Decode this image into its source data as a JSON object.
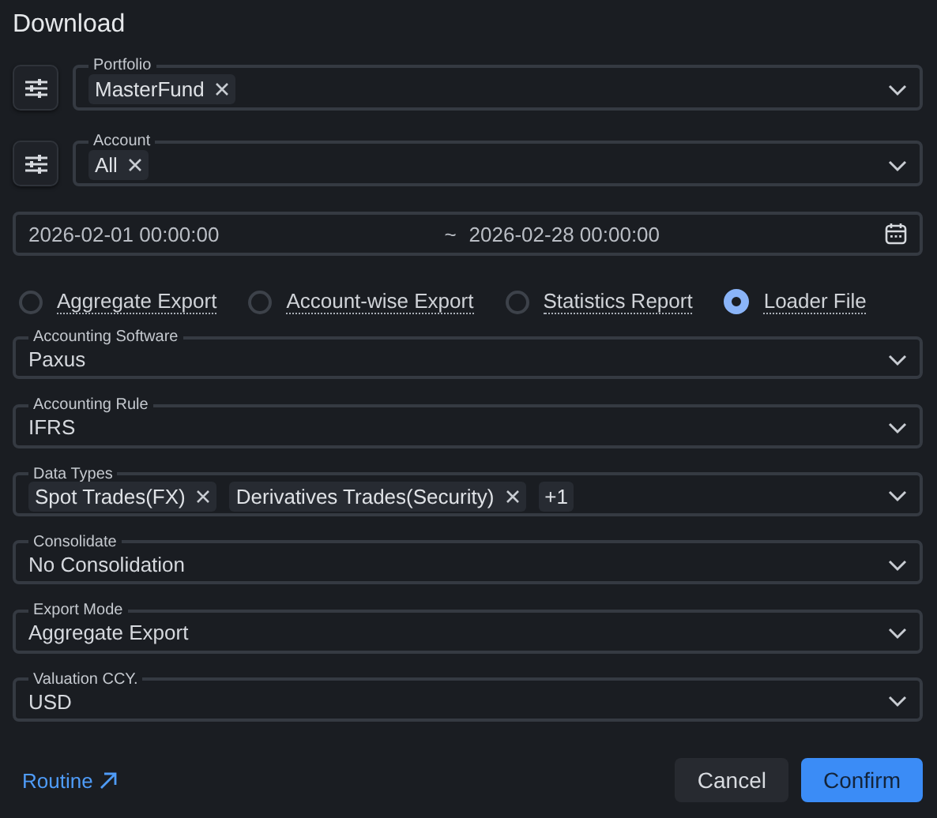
{
  "dialog": {
    "title": "Download"
  },
  "tag_fields": [
    {
      "label": "Portfolio",
      "tags": [
        "MasterFund"
      ]
    },
    {
      "label": "Account",
      "tags": [
        "All"
      ]
    }
  ],
  "date_range": {
    "start": "2026-02-01 00:00:00",
    "separator": "~",
    "end": "2026-02-28 00:00:00"
  },
  "export_options": [
    {
      "label": "Aggregate Export",
      "selected": false
    },
    {
      "label": "Account-wise Export",
      "selected": false
    },
    {
      "label": "Statistics Report",
      "selected": false
    },
    {
      "label": "Loader File",
      "selected": true
    }
  ],
  "selects": [
    {
      "kind": "single",
      "label": "Accounting Software",
      "value": "Paxus"
    },
    {
      "kind": "single",
      "label": "Accounting Rule",
      "value": "IFRS"
    },
    {
      "kind": "multi",
      "label": "Data Types",
      "tags": [
        "Spot Trades(FX)",
        "Derivatives Trades(Security)"
      ],
      "more": "+1"
    },
    {
      "kind": "single",
      "label": "Consolidate",
      "value": "No Consolidation"
    },
    {
      "kind": "single",
      "label": "Export Mode",
      "value": "Aggregate Export"
    },
    {
      "kind": "single",
      "label": "Valuation CCY.",
      "value": "USD"
    }
  ],
  "footer": {
    "link": "Routine",
    "buttons": [
      {
        "label": "Cancel",
        "kind": "secondary"
      },
      {
        "label": "Confirm",
        "kind": "primary"
      }
    ]
  }
}
